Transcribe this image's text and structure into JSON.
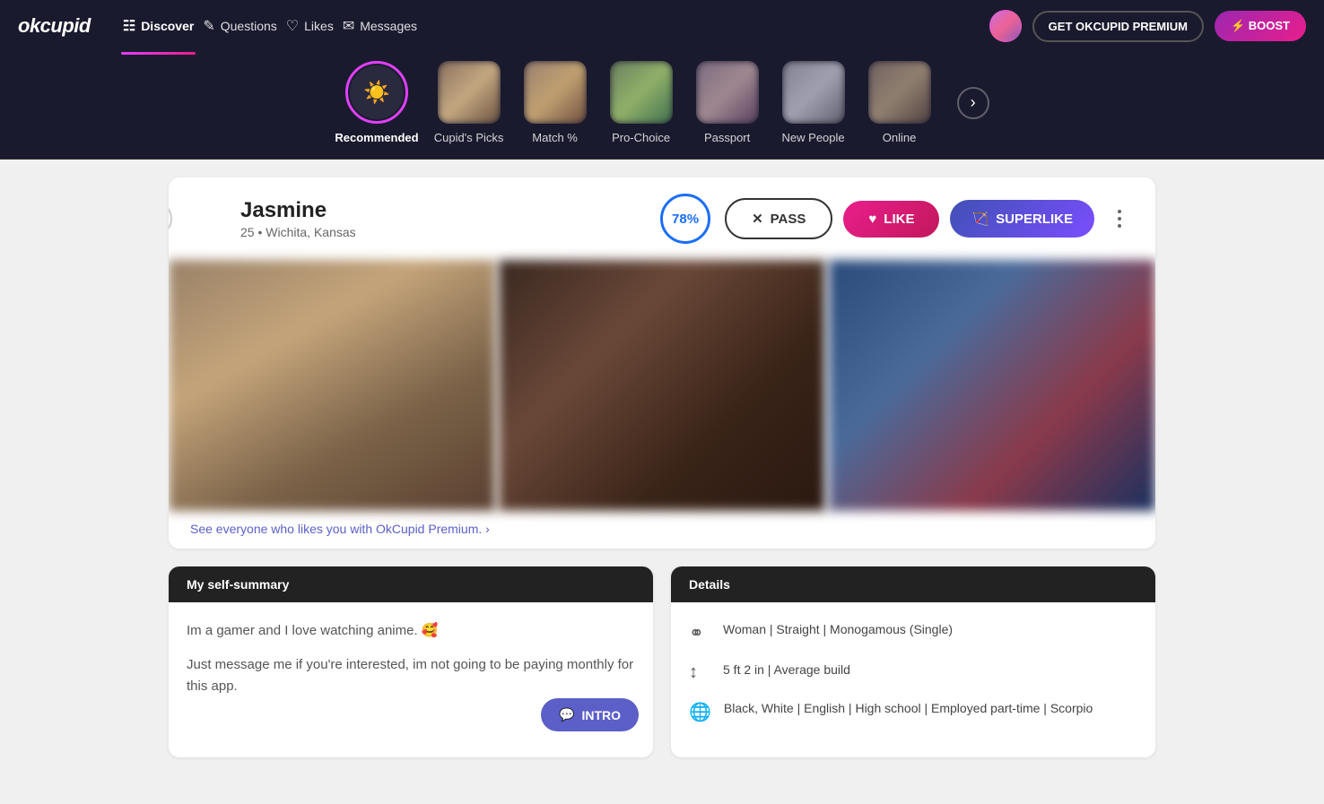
{
  "app": {
    "logo": "okcupid",
    "nav": [
      {
        "id": "discover",
        "label": "Discover",
        "icon": "🔍",
        "active": true
      },
      {
        "id": "questions",
        "label": "Questions",
        "icon": "❓"
      },
      {
        "id": "likes",
        "label": "Likes",
        "icon": "♡"
      },
      {
        "id": "messages",
        "label": "Messages",
        "icon": "💬"
      }
    ],
    "buttons": {
      "premium": "GET OKCUPID PREMIUM",
      "boost": "⚡ BOOST"
    }
  },
  "categories": [
    {
      "id": "recommended",
      "label": "Recommended",
      "active": true,
      "icon": "☀️"
    },
    {
      "id": "cupids-picks",
      "label": "Cupid's Picks",
      "active": false
    },
    {
      "id": "match",
      "label": "Match %",
      "active": false
    },
    {
      "id": "pro-choice",
      "label": "Pro-Choice",
      "active": false
    },
    {
      "id": "passport",
      "label": "Passport",
      "active": false
    },
    {
      "id": "new-people",
      "label": "New People",
      "active": false
    },
    {
      "id": "online",
      "label": "Online",
      "active": false
    }
  ],
  "profile": {
    "name": "Jasmine",
    "age": "25",
    "location": "Wichita, Kansas",
    "match_percent": "78%",
    "buttons": {
      "pass": "PASS",
      "like": "LIKE",
      "superlike": "SUPERLIKE"
    },
    "premium_prompt": "See everyone who likes you with OkCupid Premium. ›",
    "self_summary": {
      "header": "My self-summary",
      "text1": "Im a gamer and I love watching anime. 🥰",
      "text2": "Just message me if you're interested, im not going to be paying monthly for this app.",
      "intro_button": "INTRO"
    },
    "details": {
      "header": "Details",
      "orientation": "Woman | Straight | Monogamous (Single)",
      "height": "5 ft 2 in | Average build",
      "background": "Black, White | English | High school | Employed part-time | Scorpio"
    }
  }
}
